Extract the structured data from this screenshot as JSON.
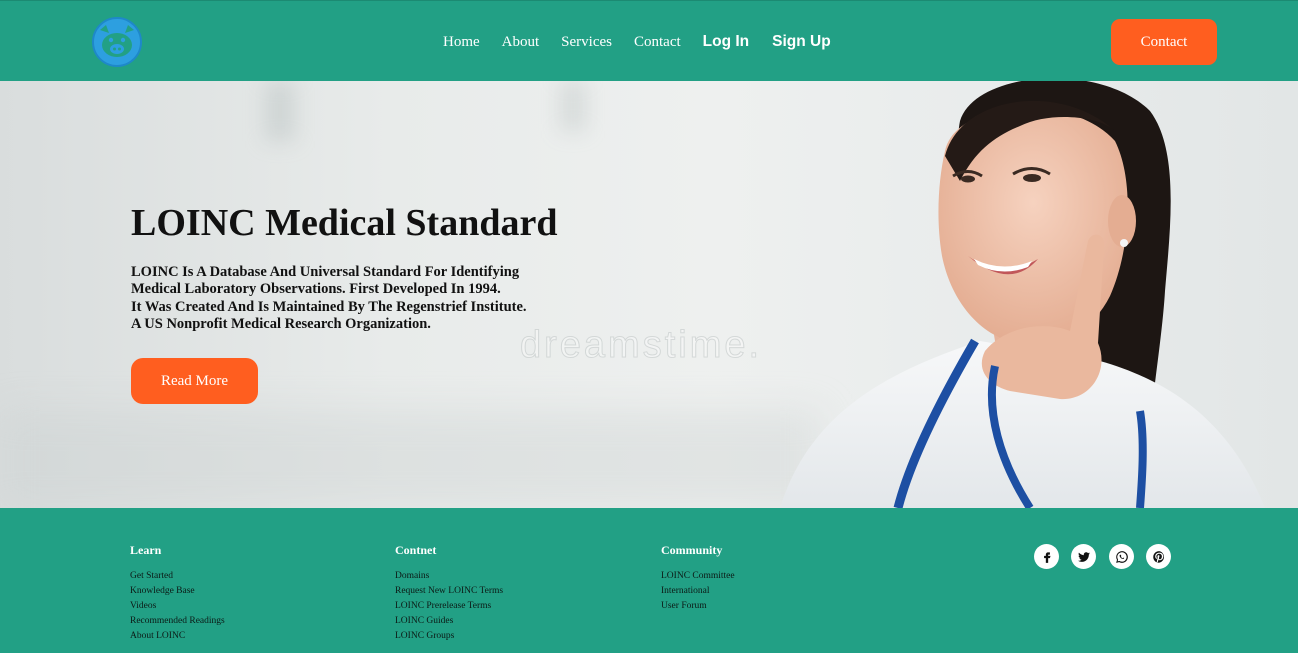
{
  "brand": {
    "logo_icon": "pig-logo-icon",
    "color": "#22a085"
  },
  "nav": {
    "items": [
      {
        "label": "Home"
      },
      {
        "label": "About"
      },
      {
        "label": "Services"
      },
      {
        "label": "Contact"
      }
    ],
    "login_label": "Log In",
    "signup_label": "Sign Up",
    "cta_label": "Contact"
  },
  "hero": {
    "title": "LOINC Medical Standard",
    "description_lines": [
      "LOINC Is A Database And Universal Standard For Identifying",
      "Medical Laboratory Observations. First Developed In 1994.",
      "It Was Created And Is Maintained By The Regenstrief Institute.",
      "A US Nonprofit Medical Research Organization."
    ],
    "button_label": "Read More",
    "watermark": "dreamstime."
  },
  "footer": {
    "columns": [
      {
        "heading": "Learn",
        "links": [
          "Get Started",
          "Knowledge Base",
          "Videos",
          "Recommended Readings",
          "About LOINC"
        ]
      },
      {
        "heading": "Contnet",
        "links": [
          "Domains",
          "Request New LOINC Terms",
          "LOINC Prerelease Terms",
          "LOINC Guides",
          "LOINC Groups"
        ]
      },
      {
        "heading": "Community",
        "links": [
          "LOINC Committee",
          "International",
          "User Forum"
        ]
      }
    ],
    "social": [
      "facebook-icon",
      "twitter-icon",
      "whatsapp-icon",
      "pinterest-icon"
    ]
  },
  "colors": {
    "accent": "#ff5e1f",
    "primary": "#22a085",
    "text": "#111111"
  }
}
